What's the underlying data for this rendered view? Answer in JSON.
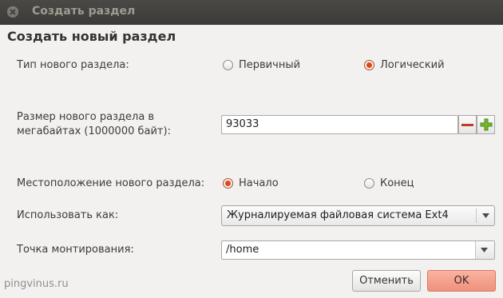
{
  "window": {
    "title": "Создать раздел",
    "heading": "Создать новый раздел"
  },
  "partition_type": {
    "label": "Тип нового раздела:",
    "options": [
      {
        "label": "Первичный",
        "selected": false
      },
      {
        "label": "Логический",
        "selected": true
      }
    ]
  },
  "size": {
    "label_line1": "Размер нового раздела в",
    "label_line2": "мегабайтах (1000000 байт):",
    "value": "93033"
  },
  "location": {
    "label": "Местоположение нового раздела:",
    "options": [
      {
        "label": "Начало",
        "selected": true
      },
      {
        "label": "Конец",
        "selected": false
      }
    ]
  },
  "use_as": {
    "label": "Использовать как:",
    "value": "Журналируемая файловая система Ext4"
  },
  "mount_point": {
    "label": "Точка монтирования:",
    "value": "/home"
  },
  "buttons": {
    "cancel": "Отменить",
    "ok": "OK"
  },
  "watermark": "pingvinus.ru",
  "colors": {
    "accent": "#dd4814",
    "ok_button": "#ef917c",
    "titlebar": "#3c3b37"
  }
}
